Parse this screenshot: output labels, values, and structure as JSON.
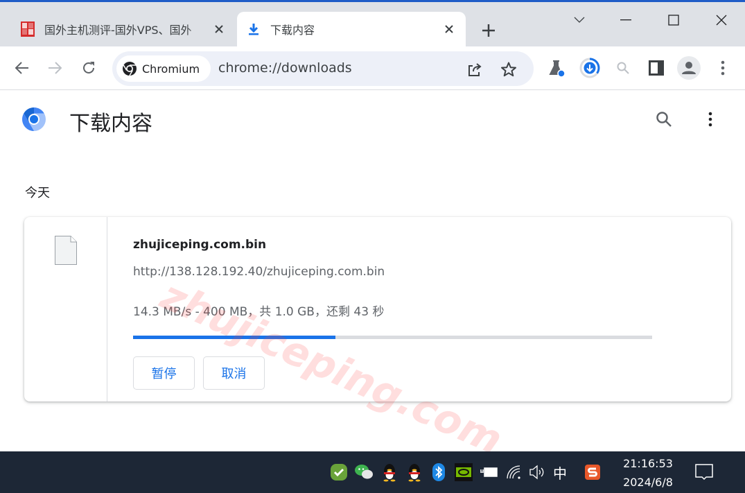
{
  "browser": {
    "tabs": [
      {
        "title": "国外主机测评-国外VPS、国外",
        "favicon": "site-seal-icon",
        "active": false
      },
      {
        "title": "下载内容",
        "favicon": "download-icon",
        "active": true
      }
    ],
    "new_tab_label": "+",
    "window_controls": [
      "tab-search",
      "minimize",
      "maximize",
      "close"
    ],
    "omnibox": {
      "chip_label": "Chromium",
      "url": "chrome://downloads"
    },
    "accent": "#1a73e8"
  },
  "page": {
    "title": "下载内容",
    "section_label": "今天",
    "download": {
      "file_name": "zhujiceping.com.bin",
      "source_url": "http://138.128.192.40/zhujiceping.com.bin",
      "status": "14.3 MB/s - 400 MB，共 1.0 GB，还剩 43 秒",
      "progress_percent": 39,
      "pause_label": "暂停",
      "cancel_label": "取消"
    },
    "watermark": "zhujiceping.com"
  },
  "taskbar": {
    "tray_icons": [
      "security-check-icon",
      "wechat-icon",
      "qq-icon",
      "qq-icon",
      "bluetooth-icon",
      "nvidia-icon",
      "battery-icon",
      "wifi-icon",
      "volume-icon"
    ],
    "ime_label": "中",
    "time": "21:16:53",
    "date": "2024/6/8"
  }
}
